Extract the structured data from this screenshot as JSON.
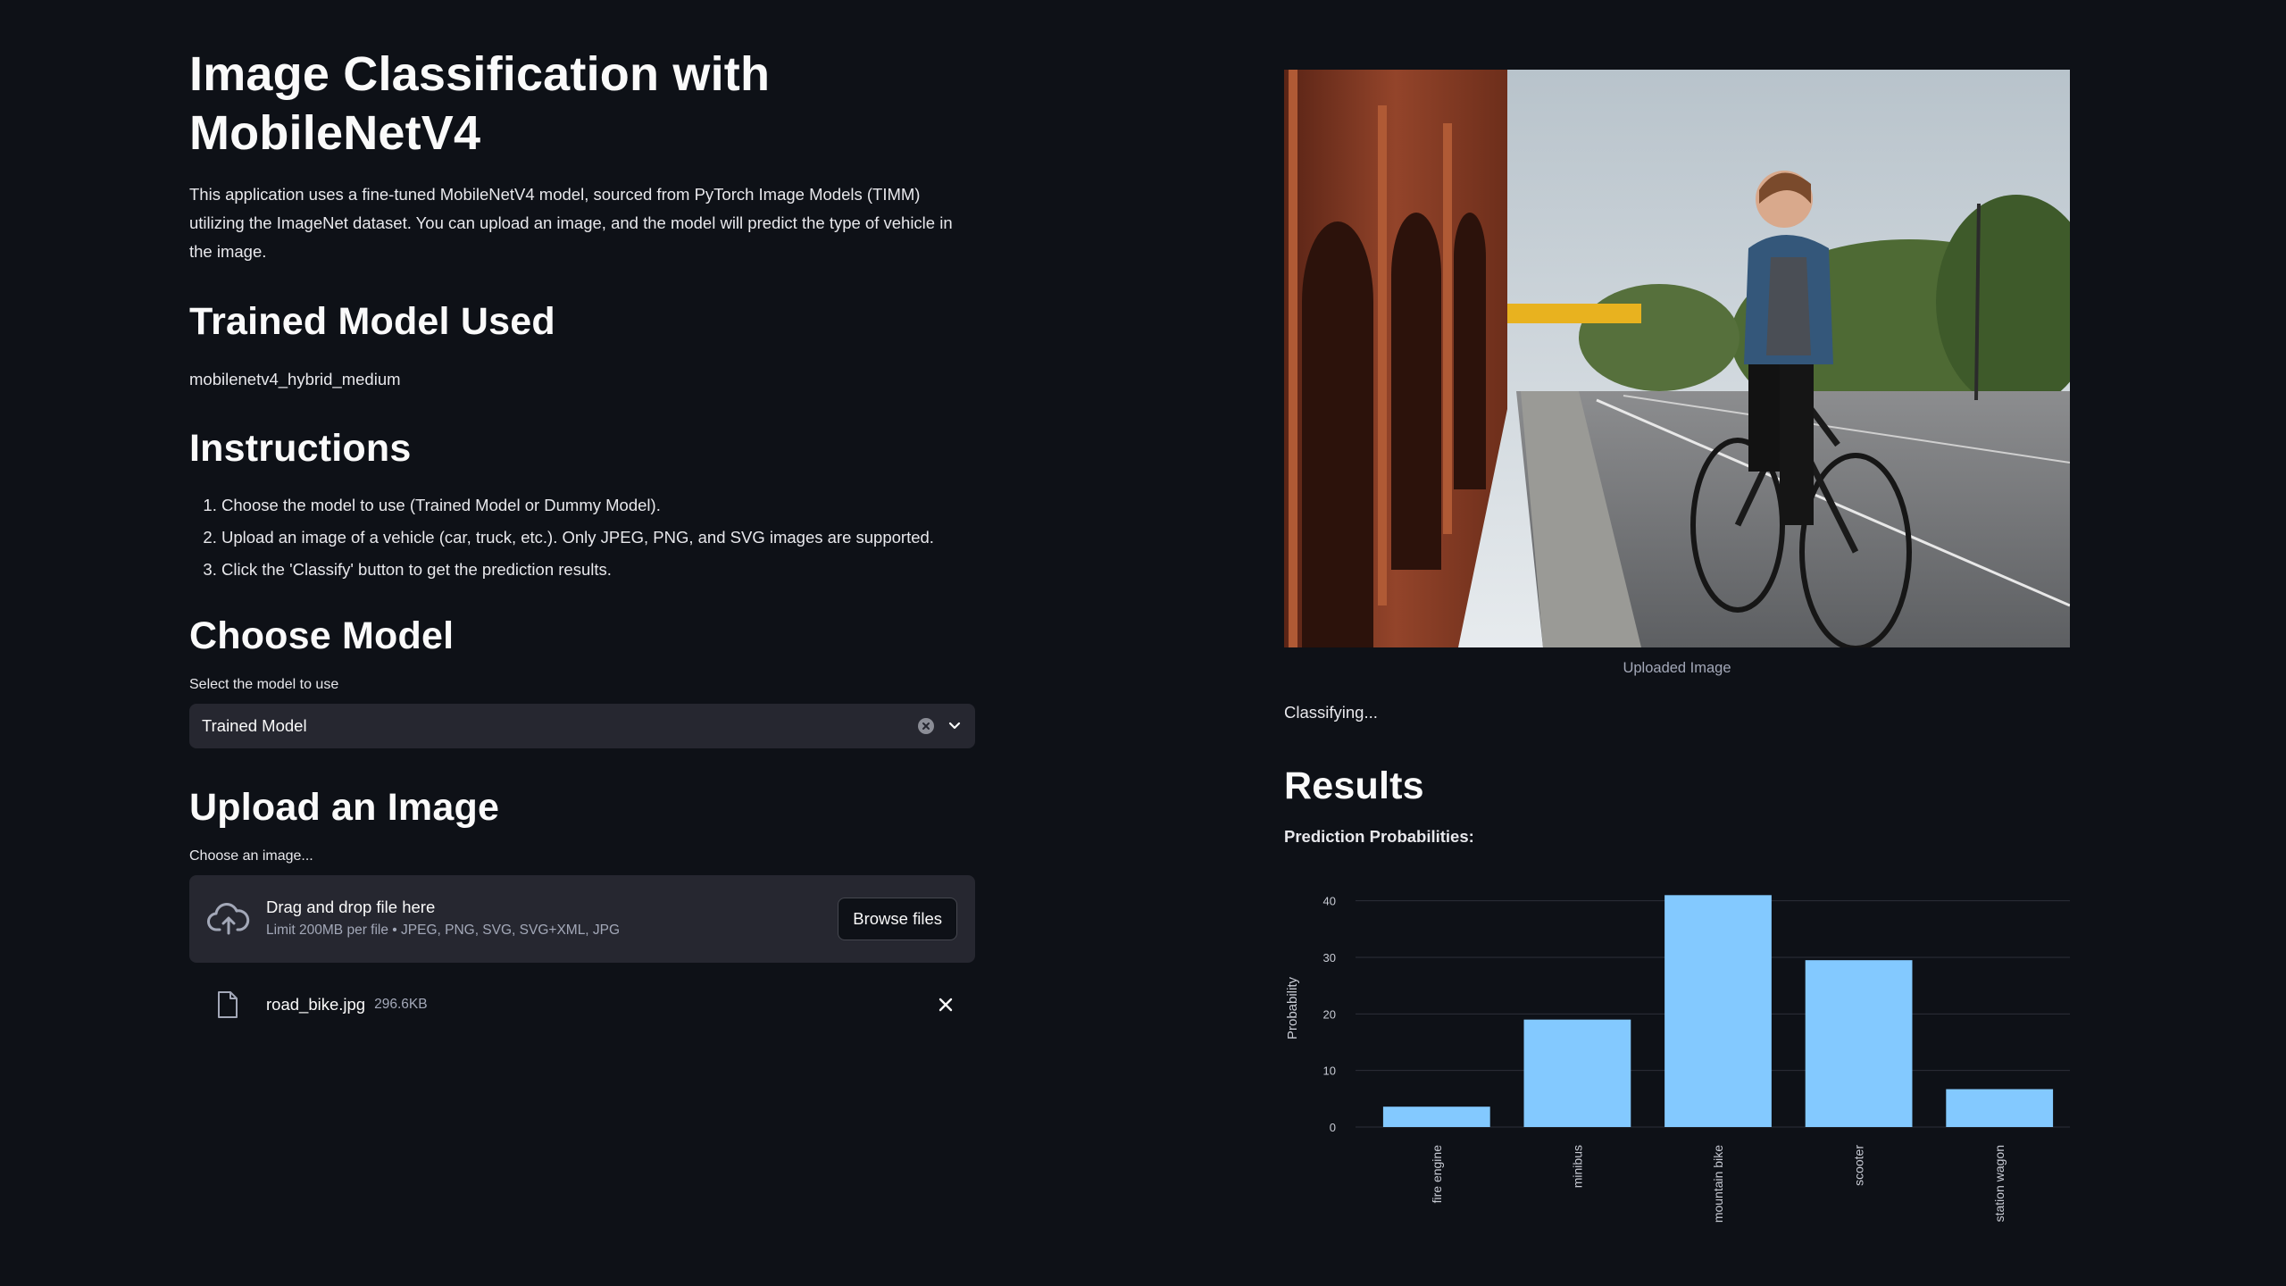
{
  "header": {
    "title": "Image Classification with MobileNetV4",
    "description": "This application uses a fine-tuned MobileNetV4 model, sourced from PyTorch Image Models (TIMM) utilizing the ImageNet dataset. You can upload an image, and the model will predict the type of vehicle in the image."
  },
  "trained_model": {
    "heading": "Trained Model Used",
    "name": "mobilenetv4_hybrid_medium"
  },
  "instructions": {
    "heading": "Instructions",
    "steps": [
      "Choose the model to use (Trained Model or Dummy Model).",
      "Upload an image of a vehicle (car, truck, etc.). Only JPEG, PNG, and SVG images are supported.",
      "Click the 'Classify' button to get the prediction results."
    ]
  },
  "choose_model": {
    "heading": "Choose Model",
    "select_label": "Select the model to use",
    "selected": "Trained Model"
  },
  "upload": {
    "heading": "Upload an Image",
    "label": "Choose an image...",
    "drop_text": "Drag and drop file here",
    "limit_text": "Limit 200MB per file • JPEG, PNG, SVG, SVG+XML, JPG",
    "browse_label": "Browse files",
    "file_name": "road_bike.jpg",
    "file_size": "296.6KB"
  },
  "image_panel": {
    "caption": "Uploaded Image",
    "status": "Classifying..."
  },
  "results": {
    "heading": "Results",
    "subheading": "Prediction Probabilities:"
  },
  "colors": {
    "background": "#0e1117",
    "widget": "#262730",
    "bar": "#83c9ff"
  },
  "chart_data": {
    "type": "bar",
    "categories": [
      "fire engine",
      "minibus",
      "mountain bike",
      "scooter",
      "station wagon"
    ],
    "values": [
      3.6,
      19,
      41,
      29.5,
      6.7
    ],
    "ylabel": "Probability",
    "xlabel": "",
    "ylim": [
      0,
      42
    ],
    "yticks": [
      0,
      10,
      20,
      30,
      40
    ],
    "grid": true
  }
}
